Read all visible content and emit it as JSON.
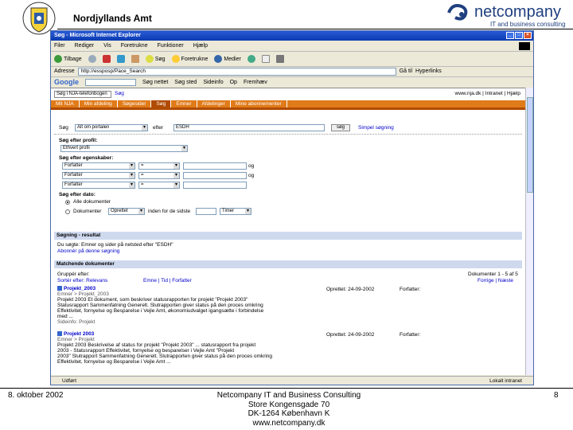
{
  "slide": {
    "organization": "Nordjyllands Amt",
    "logo_name": "netcompany",
    "logo_tagline": "IT and business consulting",
    "footer_date": "8. oktober 2002",
    "footer_company": "Netcompany IT and Business Consulting",
    "footer_street": "Store Kongensgade 70",
    "footer_city": "DK-1264 København K",
    "footer_web": "www.netcompany.dk",
    "page_number": "8"
  },
  "browser": {
    "title": "Søg - Microsoft Internet Explorer",
    "menu": [
      "Filer",
      "Rediger",
      "Vis",
      "Foretrukne",
      "Funktioner",
      "Hjælp"
    ],
    "toolbar": {
      "back": "Tilbage",
      "search": "Søg",
      "favorites": "Foretrukne",
      "media": "Medier"
    },
    "address_label": "Adresse",
    "address": "http://essposp/Pace_Search",
    "go_label": "Gå til",
    "links_label": "Hyperlinks",
    "google": {
      "logo": "Google",
      "items": [
        "Søg nettet",
        "Søg sted",
        "Sideinfo",
        "Op",
        "Fremhæv"
      ]
    },
    "status_text": "Udført",
    "status_zone": "Lokalt intranet"
  },
  "page": {
    "title_box": "Søg i NJA-telefonbogen",
    "search_link": "Søg",
    "top_links": "www.nja.dk | Intranet | Hjælp",
    "nav_tabs": [
      {
        "label": "Mit NJA",
        "active": false
      },
      {
        "label": "Min afdeling",
        "active": false
      },
      {
        "label": "Søgesider",
        "active": false
      },
      {
        "label": "Søg",
        "active": true
      },
      {
        "label": "Emner",
        "active": false
      },
      {
        "label": "Afdelinger",
        "active": false
      },
      {
        "label": "Mine abonnementer",
        "active": false
      }
    ],
    "search": {
      "label": "Søg",
      "scope": "Alt om portalen",
      "after_label": "efter",
      "query": "ESDH",
      "button": "søg",
      "simple_link": "Simpel søgning"
    },
    "profile": {
      "label": "Søg efter profil:",
      "value": "Ethvert profil"
    },
    "properties": {
      "label": "Søg efter egenskaber:",
      "rows": [
        {
          "field": "Forfatter",
          "op": "=",
          "conj": "og"
        },
        {
          "field": "Forfatter",
          "op": "=",
          "conj": "og"
        },
        {
          "field": "Forfatter",
          "op": "=",
          "conj": ""
        }
      ]
    },
    "date": {
      "label": "Søg efter dato:",
      "option_all": "Alle dokumenter",
      "option_range": "Dokumenter",
      "range_field": "Oprettet",
      "range_mid": "inden for de sidste",
      "range_unit": "Timer"
    },
    "result_section": {
      "header": "Søgning - resultat",
      "line1": "Du søgte: Emner og sider på netsted efter \"ESDH\"",
      "line2": "Abonnér på denne søgning"
    },
    "matching_section": {
      "header": "Matchende dokumenter",
      "group_label": "Gruppér efter:",
      "sort_by": "Sortér efter: Relevans",
      "links": "Emne | Tid | Forfatter",
      "range": "Dokumenter 1 - 5 af 5",
      "next": "Forrige | Næste"
    },
    "results": [
      {
        "title": "Projekt_2003",
        "sub": "Emner > Projekt_2003",
        "created": "Oprettet: 24-09-2002",
        "author": "Forfatter:",
        "lines": [
          "Projekt 2003 Et dokument, som beskriver statusrapporten for projekt \"Projekt 2003\"",
          "Statusrapport Sammenfatning Generelt. Slutrapporten giver status på den proces omkring",
          "Effektivitet, fornyelse og Besparelse i Vejle Amt, økonomiudvalget igangsætte i forbindelse",
          "med ...",
          "Sideinfo: Projekt"
        ]
      },
      {
        "title": "Projekt 2003",
        "sub": "Emner > Projekt",
        "created": "Oprettet: 24-09-2002",
        "author": "Forfatter:",
        "lines": [
          "Projekt 2003 Beskrivelse af status for projekt \"Projekt 2003\" ... statusrapport fra projekt",
          "2003 - Statusrapport Effektivitet, fornyelse og besparelser i Vejle Amt \"Projekt",
          "2003\" Slutrapport Sammenfatning Generelt. Slutrapporten giver status på den proces omkring",
          "Effektivitet, fornyelse og Besparelse i Vejle Amt ..."
        ]
      }
    ]
  },
  "colors": {
    "nav_orange": "#e07b1a",
    "section_blue": "#cfd9ee",
    "logo_blue": "#1f3f7f",
    "titlebar_blue": "#0a3bb0"
  }
}
